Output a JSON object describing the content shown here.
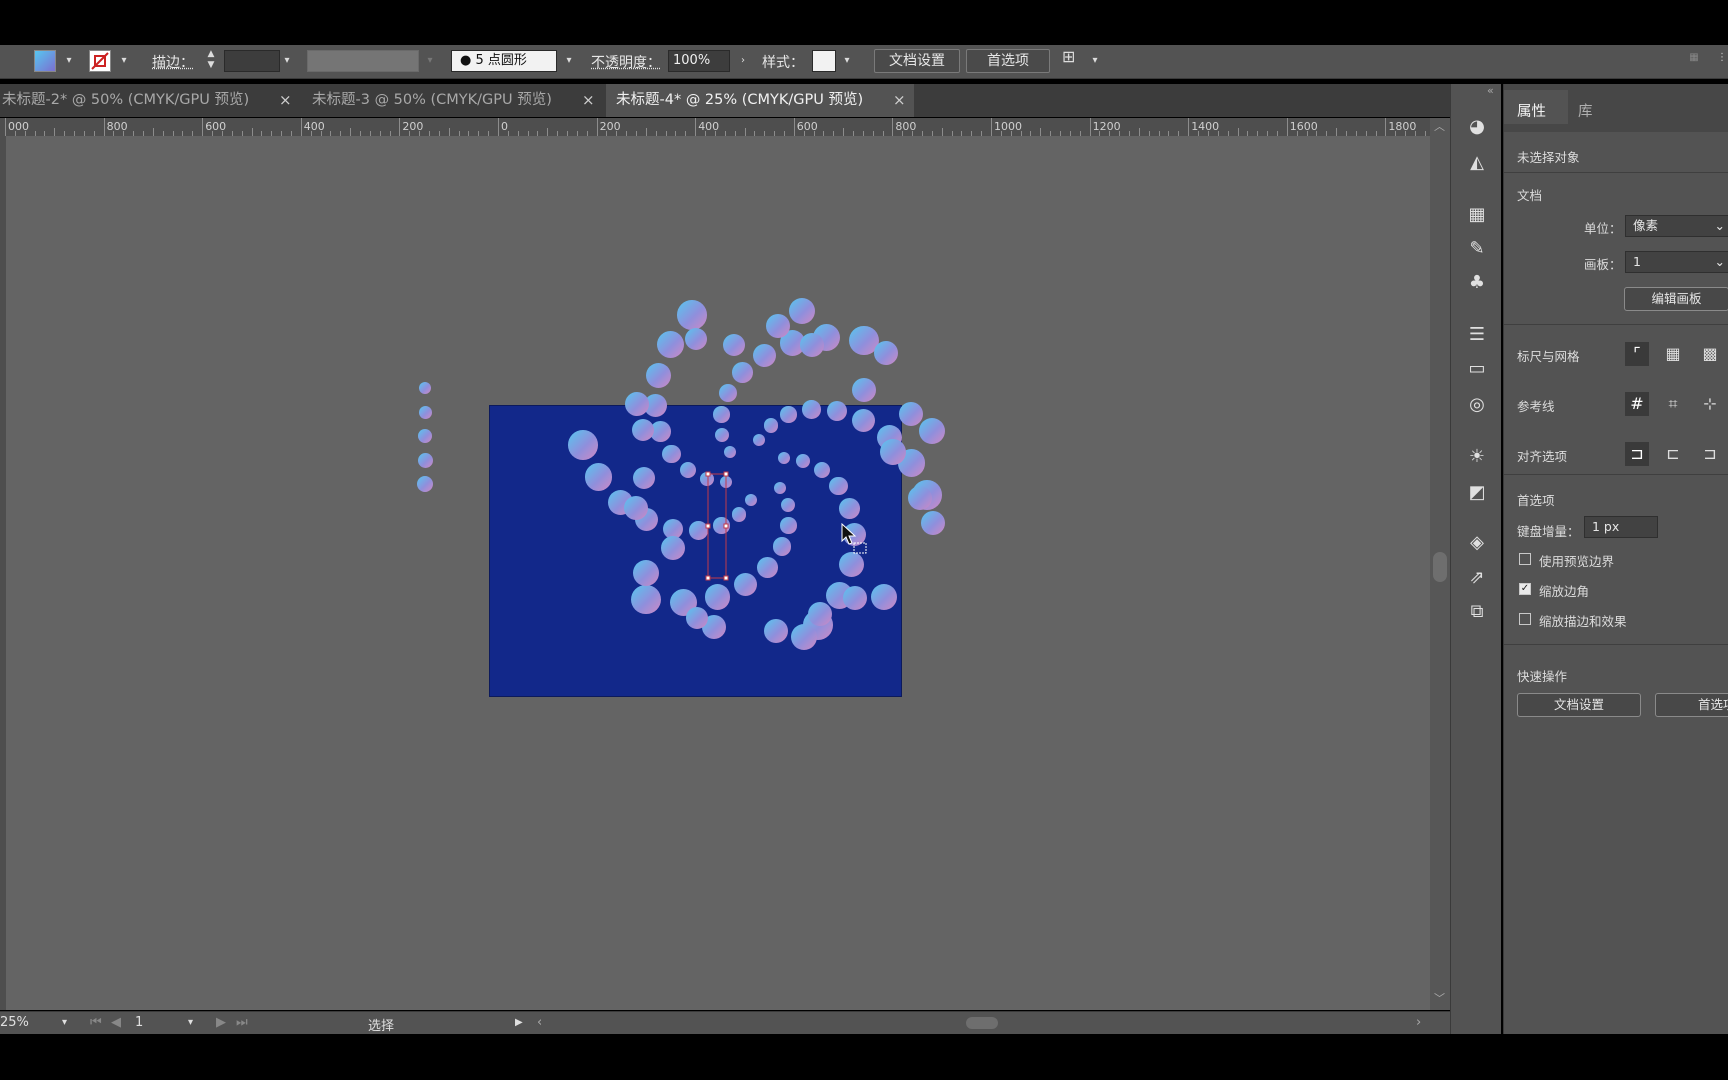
{
  "control_bar": {
    "stroke_label": "描边：",
    "brush_label": "5 点圆形",
    "opacity_label": "不透明度：",
    "opacity_value": "100%",
    "style_label": "样式：",
    "doc_setup_button": "文档设置",
    "preferences_button": "首选项"
  },
  "tabs": [
    {
      "label": "未标题-2* @ 50% (CMYK/GPU 预览)",
      "active": false
    },
    {
      "label": "未标题-3 @ 50% (CMYK/GPU 预览)",
      "active": false
    },
    {
      "label": "未标题-4* @ 25% (CMYK/GPU 预览)",
      "active": true
    }
  ],
  "tab_close_glyph": "×",
  "ruler_labels": [
    "000",
    "800",
    "600",
    "400",
    "200",
    "0",
    "200",
    "400",
    "600",
    "800",
    "1000",
    "1200",
    "1400",
    "1600",
    "1800"
  ],
  "status_bar": {
    "zoom": "25%",
    "artboard_number": "1",
    "tool_name": "选择"
  },
  "properties_panel": {
    "tab_properties": "属性",
    "tab_library": "库",
    "no_selection": "未选择对象",
    "document_section": "文档",
    "units_label": "单位：",
    "units_value": "像素",
    "artboard_label": "画板：",
    "artboard_value": "1",
    "edit_artboard_button": "编辑画板",
    "rulers_grids_label": "标尺与网格",
    "guides_label": "参考线",
    "align_options_label": "对齐选项",
    "preferences_section": "首选项",
    "keyboard_increment_label": "键盘增量：",
    "keyboard_increment_value": "1 px",
    "use_preview_bounds": "使用预览边界",
    "use_preview_bounds_checked": false,
    "scale_corners": "缩放边角",
    "scale_corners_checked": true,
    "scale_strokes_effects": "缩放描边和效果",
    "scale_strokes_effects_checked": false,
    "quick_actions": "快速操作",
    "quick_doc_setup_button": "文档设置",
    "quick_preferences_button": "首选项"
  },
  "colors": {
    "artboard": "#12288a",
    "dot_gradient_start": "#57c7f0",
    "dot_gradient_end": "#d08ac4",
    "canvas": "#646464"
  },
  "icons": [
    "fill-swatch-icon",
    "stroke-swatch-icon",
    "arrange-documents-icon",
    "color-guide-icon",
    "image-trace-icon",
    "swatches-icon",
    "brushes-icon",
    "symbols-icon",
    "stroke-panel-icon",
    "gradient-panel-icon",
    "transparency-icon",
    "appearance-icon",
    "graphic-styles-icon",
    "layers-icon",
    "export-icon",
    "artboards-icon"
  ]
}
